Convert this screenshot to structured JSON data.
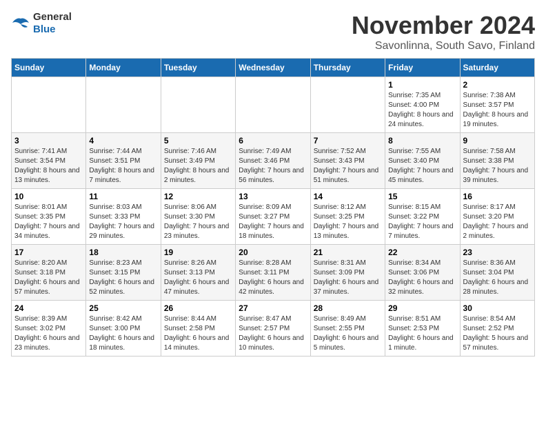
{
  "header": {
    "logo_general": "General",
    "logo_blue": "Blue",
    "month_title": "November 2024",
    "location": "Savonlinna, South Savo, Finland"
  },
  "weekdays": [
    "Sunday",
    "Monday",
    "Tuesday",
    "Wednesday",
    "Thursday",
    "Friday",
    "Saturday"
  ],
  "weeks": [
    [
      {
        "day": "",
        "info": ""
      },
      {
        "day": "",
        "info": ""
      },
      {
        "day": "",
        "info": ""
      },
      {
        "day": "",
        "info": ""
      },
      {
        "day": "",
        "info": ""
      },
      {
        "day": "1",
        "info": "Sunrise: 7:35 AM\nSunset: 4:00 PM\nDaylight: 8 hours and 24 minutes."
      },
      {
        "day": "2",
        "info": "Sunrise: 7:38 AM\nSunset: 3:57 PM\nDaylight: 8 hours and 19 minutes."
      }
    ],
    [
      {
        "day": "3",
        "info": "Sunrise: 7:41 AM\nSunset: 3:54 PM\nDaylight: 8 hours and 13 minutes."
      },
      {
        "day": "4",
        "info": "Sunrise: 7:44 AM\nSunset: 3:51 PM\nDaylight: 8 hours and 7 minutes."
      },
      {
        "day": "5",
        "info": "Sunrise: 7:46 AM\nSunset: 3:49 PM\nDaylight: 8 hours and 2 minutes."
      },
      {
        "day": "6",
        "info": "Sunrise: 7:49 AM\nSunset: 3:46 PM\nDaylight: 7 hours and 56 minutes."
      },
      {
        "day": "7",
        "info": "Sunrise: 7:52 AM\nSunset: 3:43 PM\nDaylight: 7 hours and 51 minutes."
      },
      {
        "day": "8",
        "info": "Sunrise: 7:55 AM\nSunset: 3:40 PM\nDaylight: 7 hours and 45 minutes."
      },
      {
        "day": "9",
        "info": "Sunrise: 7:58 AM\nSunset: 3:38 PM\nDaylight: 7 hours and 39 minutes."
      }
    ],
    [
      {
        "day": "10",
        "info": "Sunrise: 8:01 AM\nSunset: 3:35 PM\nDaylight: 7 hours and 34 minutes."
      },
      {
        "day": "11",
        "info": "Sunrise: 8:03 AM\nSunset: 3:33 PM\nDaylight: 7 hours and 29 minutes."
      },
      {
        "day": "12",
        "info": "Sunrise: 8:06 AM\nSunset: 3:30 PM\nDaylight: 7 hours and 23 minutes."
      },
      {
        "day": "13",
        "info": "Sunrise: 8:09 AM\nSunset: 3:27 PM\nDaylight: 7 hours and 18 minutes."
      },
      {
        "day": "14",
        "info": "Sunrise: 8:12 AM\nSunset: 3:25 PM\nDaylight: 7 hours and 13 minutes."
      },
      {
        "day": "15",
        "info": "Sunrise: 8:15 AM\nSunset: 3:22 PM\nDaylight: 7 hours and 7 minutes."
      },
      {
        "day": "16",
        "info": "Sunrise: 8:17 AM\nSunset: 3:20 PM\nDaylight: 7 hours and 2 minutes."
      }
    ],
    [
      {
        "day": "17",
        "info": "Sunrise: 8:20 AM\nSunset: 3:18 PM\nDaylight: 6 hours and 57 minutes."
      },
      {
        "day": "18",
        "info": "Sunrise: 8:23 AM\nSunset: 3:15 PM\nDaylight: 6 hours and 52 minutes."
      },
      {
        "day": "19",
        "info": "Sunrise: 8:26 AM\nSunset: 3:13 PM\nDaylight: 6 hours and 47 minutes."
      },
      {
        "day": "20",
        "info": "Sunrise: 8:28 AM\nSunset: 3:11 PM\nDaylight: 6 hours and 42 minutes."
      },
      {
        "day": "21",
        "info": "Sunrise: 8:31 AM\nSunset: 3:09 PM\nDaylight: 6 hours and 37 minutes."
      },
      {
        "day": "22",
        "info": "Sunrise: 8:34 AM\nSunset: 3:06 PM\nDaylight: 6 hours and 32 minutes."
      },
      {
        "day": "23",
        "info": "Sunrise: 8:36 AM\nSunset: 3:04 PM\nDaylight: 6 hours and 28 minutes."
      }
    ],
    [
      {
        "day": "24",
        "info": "Sunrise: 8:39 AM\nSunset: 3:02 PM\nDaylight: 6 hours and 23 minutes."
      },
      {
        "day": "25",
        "info": "Sunrise: 8:42 AM\nSunset: 3:00 PM\nDaylight: 6 hours and 18 minutes."
      },
      {
        "day": "26",
        "info": "Sunrise: 8:44 AM\nSunset: 2:58 PM\nDaylight: 6 hours and 14 minutes."
      },
      {
        "day": "27",
        "info": "Sunrise: 8:47 AM\nSunset: 2:57 PM\nDaylight: 6 hours and 10 minutes."
      },
      {
        "day": "28",
        "info": "Sunrise: 8:49 AM\nSunset: 2:55 PM\nDaylight: 6 hours and 5 minutes."
      },
      {
        "day": "29",
        "info": "Sunrise: 8:51 AM\nSunset: 2:53 PM\nDaylight: 6 hours and 1 minute."
      },
      {
        "day": "30",
        "info": "Sunrise: 8:54 AM\nSunset: 2:52 PM\nDaylight: 5 hours and 57 minutes."
      }
    ]
  ]
}
